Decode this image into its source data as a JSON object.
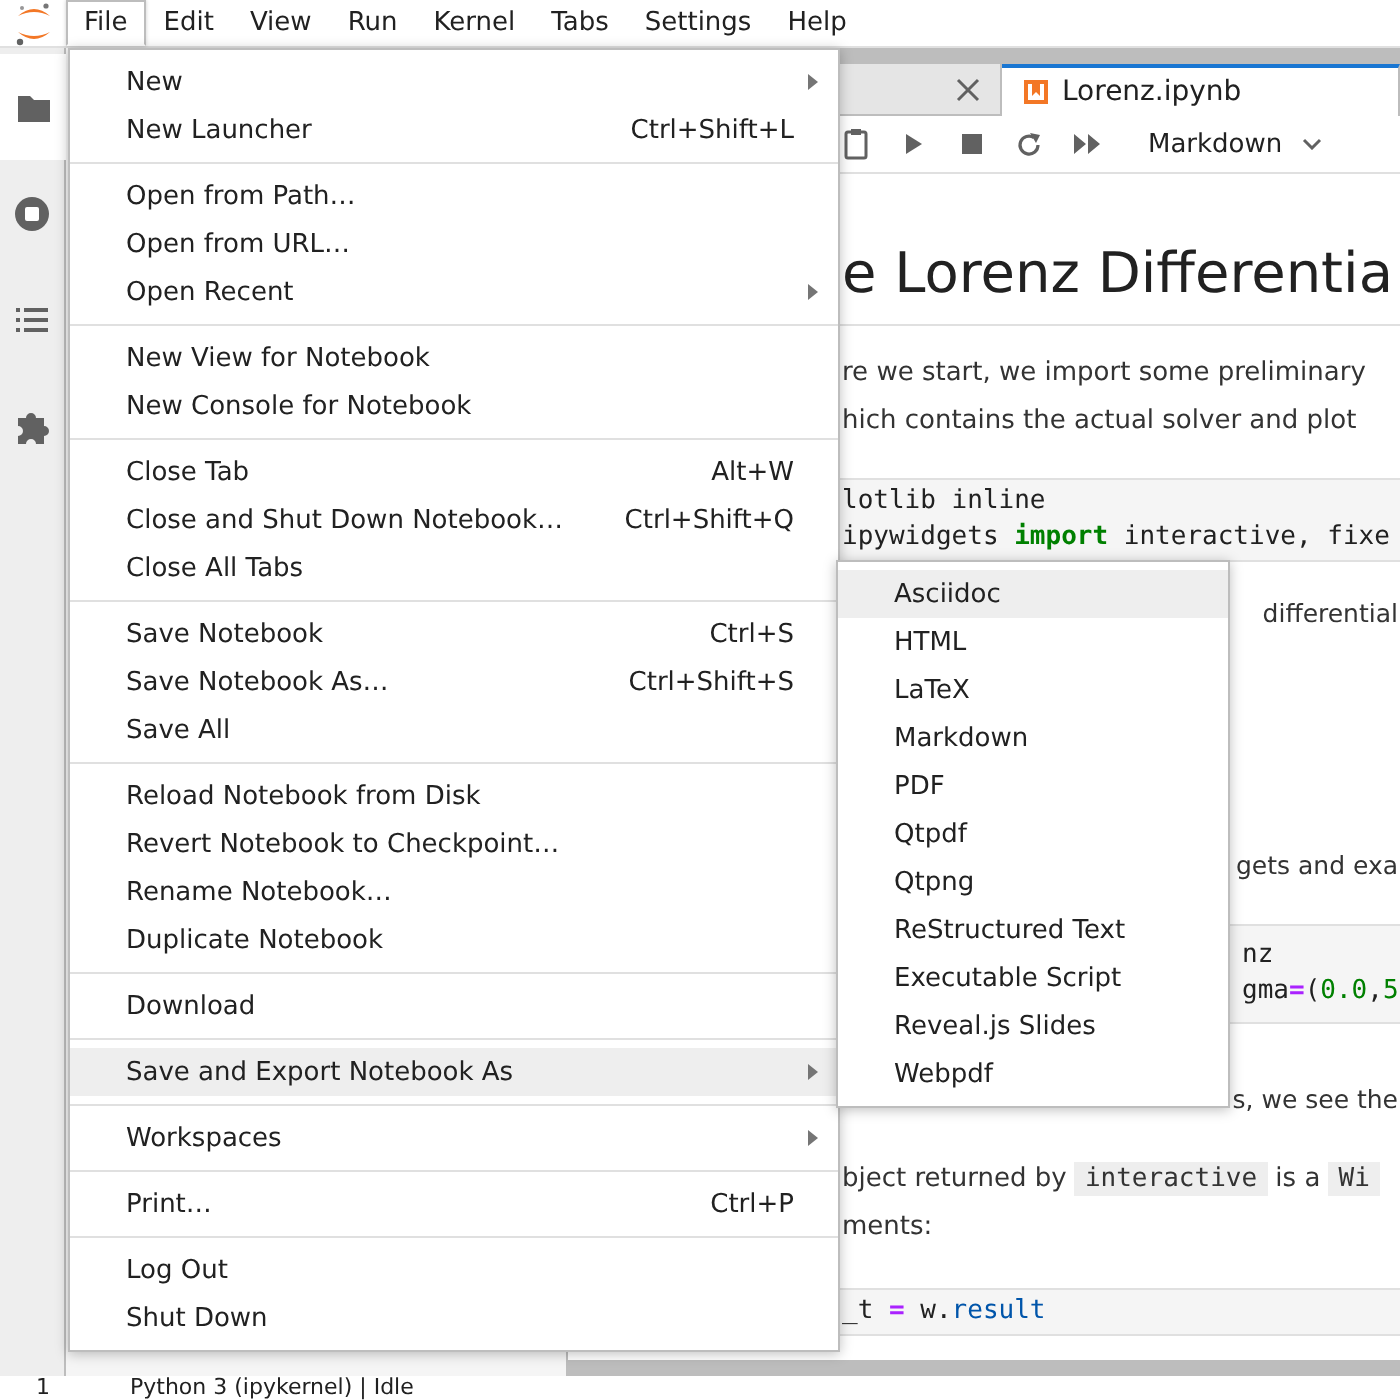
{
  "menubar": [
    {
      "label": "File",
      "selected": true
    },
    {
      "label": "Edit",
      "selected": false
    },
    {
      "label": "View",
      "selected": false
    },
    {
      "label": "Run",
      "selected": false
    },
    {
      "label": "Kernel",
      "selected": false
    },
    {
      "label": "Tabs",
      "selected": false
    },
    {
      "label": "Settings",
      "selected": false
    },
    {
      "label": "Help",
      "selected": false
    }
  ],
  "sidebar": {
    "items": [
      {
        "kind": "folder",
        "selected": true
      },
      {
        "kind": "running",
        "selected": false
      },
      {
        "kind": "toc",
        "selected": false
      },
      {
        "kind": "extensions",
        "selected": false
      }
    ]
  },
  "tabs": [
    {
      "selected": false
    },
    {
      "label": "Lorenz.ipynb",
      "selected": true
    }
  ],
  "toolbar": {
    "cell_type": "Markdown"
  },
  "notebook": {
    "cells": [
      {
        "kind": "heading",
        "lines": [
          [
            {
              "text": "e Lorenz Differentia"
            }
          ]
        ]
      },
      {
        "kind": "markdown",
        "lines": [
          [
            {
              "text": "re we start, we import some preliminary"
            }
          ],
          [
            {
              "text": "hich contains the actual solver and plot"
            }
          ]
        ]
      },
      {
        "kind": "code",
        "lines": [
          [
            {
              "text": "lotlib inline"
            }
          ],
          [
            {
              "text": " ipywidgets "
            },
            {
              "text": "import",
              "kind": "keyword"
            },
            {
              "text": " interactive, fixe"
            }
          ]
        ]
      },
      {
        "kind": "markdown-tail",
        "lines": [
          [
            {
              "text": "differential"
            }
          ]
        ]
      },
      {
        "kind": "markdown-tail",
        "lines": [
          [
            {
              "text": "gets and exa"
            }
          ]
        ]
      },
      {
        "kind": "code-tail",
        "lines": [
          [
            {
              "text": "nz"
            }
          ],
          [
            {
              "text": "gma"
            },
            {
              "text": "=",
              "kind": "operator"
            },
            {
              "text": "("
            },
            {
              "text": "0.0",
              "kind": "number"
            },
            {
              "text": ","
            },
            {
              "text": "5",
              "kind": "number"
            }
          ]
        ]
      },
      {
        "kind": "markdown-tail",
        "lines": [
          [
            {
              "text": "s, we see the"
            }
          ]
        ]
      },
      {
        "kind": "markdown",
        "lines": [
          [
            {
              "text": "bject returned by "
            },
            {
              "text": "interactive",
              "kind": "code"
            },
            {
              "text": " is a "
            },
            {
              "text": "Wi",
              "kind": "code"
            }
          ],
          [
            {
              "text": "ments:"
            }
          ]
        ]
      },
      {
        "kind": "code",
        "lines": [
          [
            {
              "text": "_t "
            },
            {
              "text": "=",
              "kind": "operator"
            },
            {
              "text": " w."
            },
            {
              "text": "result",
              "kind": "attribute"
            }
          ]
        ]
      }
    ]
  },
  "file_menu": {
    "groups": [
      [
        {
          "label": "New",
          "submenu": true,
          "selected": false
        },
        {
          "label": "New Launcher",
          "shortcut": "Ctrl+Shift+L",
          "submenu": false,
          "selected": false
        }
      ],
      [
        {
          "label": "Open from Path…",
          "submenu": false,
          "selected": false
        },
        {
          "label": "Open from URL…",
          "submenu": false,
          "selected": false
        },
        {
          "label": "Open Recent",
          "submenu": true,
          "selected": false
        }
      ],
      [
        {
          "label": "New View for Notebook",
          "submenu": false,
          "selected": false
        },
        {
          "label": "New Console for Notebook",
          "submenu": false,
          "selected": false
        }
      ],
      [
        {
          "label": "Close Tab",
          "shortcut": "Alt+W",
          "submenu": false,
          "selected": false
        },
        {
          "label": "Close and Shut Down Notebook…",
          "shortcut": "Ctrl+Shift+Q",
          "submenu": false,
          "selected": false
        },
        {
          "label": "Close All Tabs",
          "submenu": false,
          "selected": false
        }
      ],
      [
        {
          "label": "Save Notebook",
          "shortcut": "Ctrl+S",
          "submenu": false,
          "selected": false
        },
        {
          "label": "Save Notebook As…",
          "shortcut": "Ctrl+Shift+S",
          "submenu": false,
          "selected": false
        },
        {
          "label": "Save All",
          "submenu": false,
          "selected": false
        }
      ],
      [
        {
          "label": "Reload Notebook from Disk",
          "submenu": false,
          "selected": false
        },
        {
          "label": "Revert Notebook to Checkpoint…",
          "submenu": false,
          "selected": false
        },
        {
          "label": "Rename Notebook…",
          "submenu": false,
          "selected": false
        },
        {
          "label": "Duplicate Notebook",
          "submenu": false,
          "selected": false
        }
      ],
      [
        {
          "label": "Download",
          "submenu": false,
          "selected": false
        }
      ],
      [
        {
          "label": "Save and Export Notebook As",
          "submenu": true,
          "selected": true
        }
      ],
      [
        {
          "label": "Workspaces",
          "submenu": true,
          "selected": false
        }
      ],
      [
        {
          "label": "Print…",
          "shortcut": "Ctrl+P",
          "submenu": false,
          "selected": false
        }
      ],
      [
        {
          "label": "Log Out",
          "submenu": false,
          "selected": false
        },
        {
          "label": "Shut Down",
          "submenu": false,
          "selected": false
        }
      ]
    ]
  },
  "export_submenu": {
    "items": [
      {
        "label": "Asciidoc",
        "selected": true
      },
      {
        "label": "HTML",
        "selected": false
      },
      {
        "label": "LaTeX",
        "selected": false
      },
      {
        "label": "Markdown",
        "selected": false
      },
      {
        "label": "PDF",
        "selected": false
      },
      {
        "label": "Qtpdf",
        "selected": false
      },
      {
        "label": "Qtpng",
        "selected": false
      },
      {
        "label": "ReStructured Text",
        "selected": false
      },
      {
        "label": "Executable Script",
        "selected": false
      },
      {
        "label": "Reveal.js Slides",
        "selected": false
      },
      {
        "label": "Webpdf",
        "selected": false
      }
    ]
  },
  "status_bar": {
    "items": [
      "1",
      "Python 3 (ipykernel) | Idle"
    ]
  }
}
